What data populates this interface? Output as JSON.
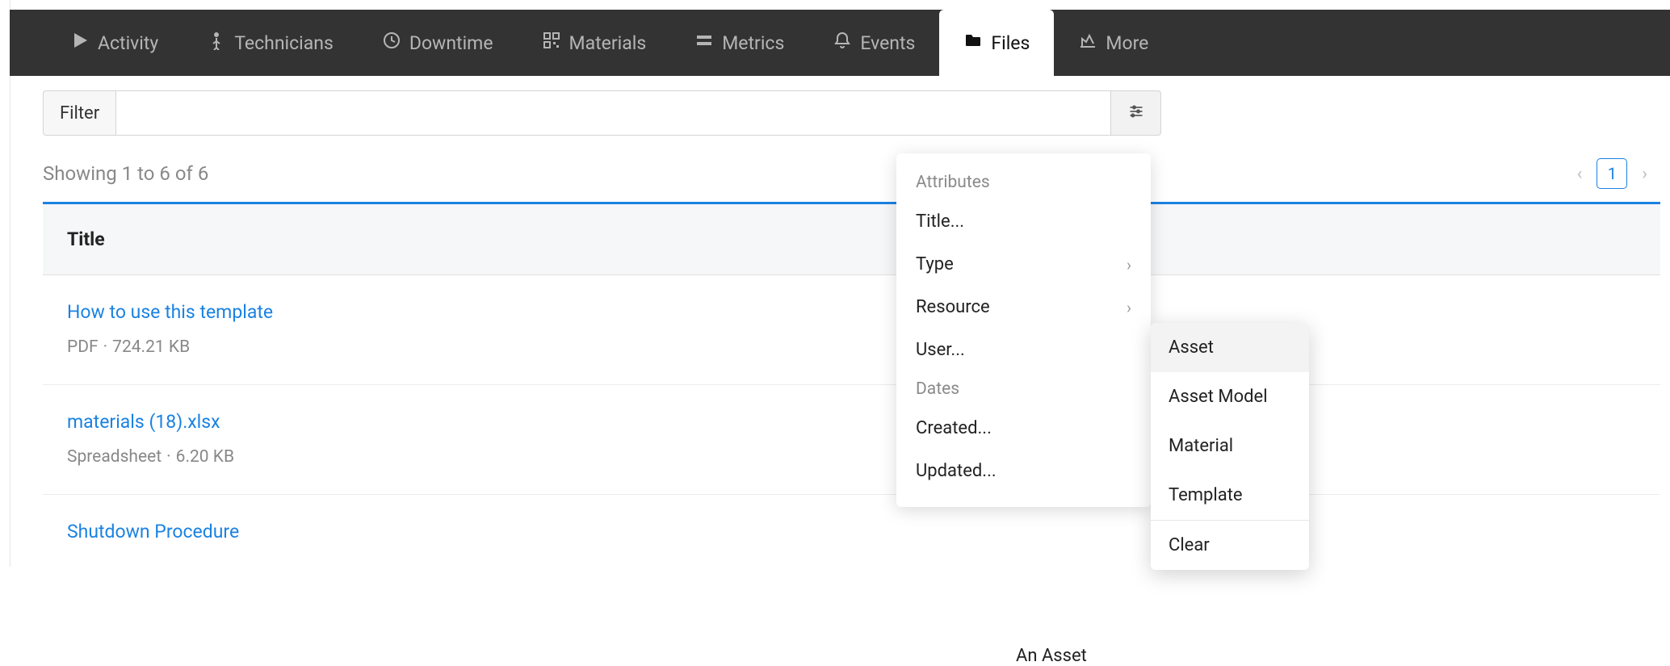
{
  "tabs": {
    "activity": "Activity",
    "technicians": "Technicians",
    "downtime": "Downtime",
    "materials": "Materials",
    "metrics": "Metrics",
    "events": "Events",
    "files": "Files",
    "more": "More"
  },
  "filter": {
    "label": "Filter",
    "value": "",
    "placeholder": ""
  },
  "listing": {
    "showing": "Showing 1 to 6 of 6",
    "page": "1",
    "column_title": "Title"
  },
  "files": [
    {
      "title": "How to use this template",
      "type": "PDF",
      "size": "724.21 KB"
    },
    {
      "title": "materials (18).xlsx",
      "type": "Spreadsheet",
      "size": "6.20 KB"
    },
    {
      "title": "Shutdown Procedure",
      "type": "",
      "size": ""
    }
  ],
  "attributes_menu": {
    "header_attributes": "Attributes",
    "title": "Title...",
    "type": "Type",
    "resource": "Resource",
    "user": "User...",
    "header_dates": "Dates",
    "created": "Created...",
    "updated": "Updated..."
  },
  "resource_submenu": {
    "asset": "Asset",
    "asset_model": "Asset Model",
    "material": "Material",
    "template": "Template",
    "clear": "Clear"
  },
  "extra_text": "An Asset"
}
